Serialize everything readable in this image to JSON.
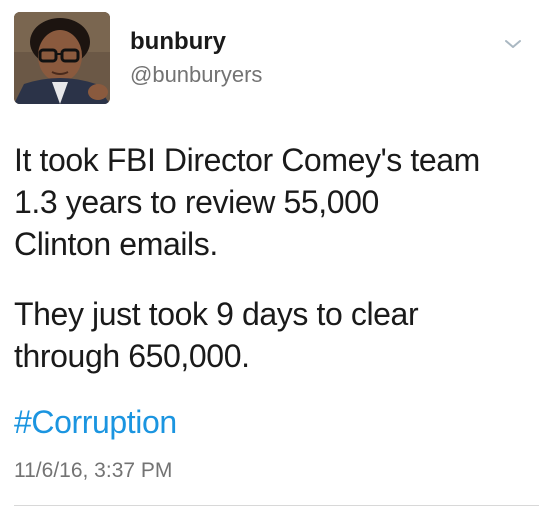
{
  "tweet": {
    "display_name": "bunbury",
    "handle": "@bunburyers",
    "body_lines_1": [
      "It took FBI Director Comey's team",
      "1.3 years to review 55,000",
      "Clinton emails."
    ],
    "body_lines_2": [
      "They just took 9 days to clear",
      "through 650,000."
    ],
    "hashtag": "#Corruption",
    "timestamp": "11/6/16, 3:37 PM"
  },
  "icons": {
    "menu": "chevron-down-icon",
    "avatar": "avatar"
  },
  "colors": {
    "hashtag": "#1b95e0",
    "secondary_text": "#737373",
    "primary_text": "#1a1a1a"
  }
}
